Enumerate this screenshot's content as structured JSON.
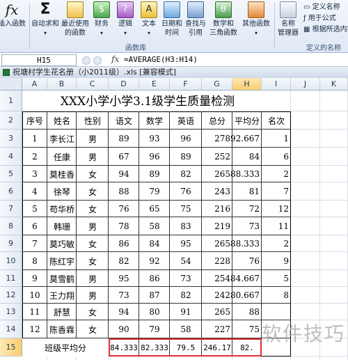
{
  "ribbon": {
    "buttons": [
      {
        "label": "插入函数",
        "icon": "insert-function-icon"
      },
      {
        "label": "自动求和",
        "icon": "autosum-icon",
        "has_dropdown": true
      },
      {
        "label": "最近使用的函数",
        "line1": "最近使用",
        "line2": "的函数",
        "icon": "recent-functions-icon",
        "has_dropdown": true
      },
      {
        "label": "财务",
        "icon": "financial-icon",
        "has_dropdown": true
      },
      {
        "label": "逻辑",
        "icon": "logical-icon",
        "has_dropdown": true
      },
      {
        "label": "文本",
        "icon": "text-icon",
        "has_dropdown": true
      },
      {
        "label": "日期和时间",
        "line1": "日期和",
        "line2": "时间",
        "icon": "date-time-icon",
        "has_dropdown": true
      },
      {
        "label": "查找与引用",
        "line1": "查找与",
        "line2": "引用",
        "icon": "lookup-icon",
        "has_dropdown": true
      },
      {
        "label": "数学和三角函数",
        "line1": "数学和",
        "line2": "三角函数",
        "icon": "math-trig-icon",
        "has_dropdown": true
      },
      {
        "label": "其他函数",
        "icon": "more-functions-icon",
        "has_dropdown": true
      },
      {
        "label": "名称管理器",
        "line1": "名称",
        "line2": "管理器",
        "icon": "name-manager-icon"
      }
    ],
    "group_function_library": "函数库",
    "group_defined_names": "定义的名称",
    "define_name": "定义名称",
    "use_in_formula": "用于公式",
    "create_from_selection": "根据所选内容"
  },
  "formula_bar": {
    "name_box": "H15",
    "fx": "fx",
    "formula": "=AVERAGE(H3:H14)"
  },
  "workbook": {
    "title": "祝塘村学生花名册（小2011级）.xls  [兼容模式]"
  },
  "columns": [
    "A",
    "B",
    "C",
    "D",
    "E",
    "F",
    "G",
    "H",
    "I",
    "J",
    "K"
  ],
  "rows": [
    "1",
    "2",
    "3",
    "4",
    "5",
    "6",
    "7",
    "8",
    "9",
    "10",
    "11",
    "12",
    "13",
    "14",
    "15"
  ],
  "sheet": {
    "title": "XXX小学小学3.1级学生质量检测",
    "headers": [
      "序号",
      "姓名",
      "性别",
      "语文",
      "数学",
      "英语",
      "总分",
      "平均分",
      "名次"
    ],
    "students": [
      {
        "no": "1",
        "name": "李长江",
        "sex": "男",
        "chinese": "89",
        "math": "93",
        "english": "96",
        "total": "278",
        "avg": "92.667",
        "rank": "1"
      },
      {
        "no": "2",
        "name": "任康",
        "sex": "男",
        "chinese": "67",
        "math": "96",
        "english": "89",
        "total": "252",
        "avg": "84",
        "rank": "6"
      },
      {
        "no": "3",
        "name": "莫桂香",
        "sex": "女",
        "chinese": "94",
        "math": "89",
        "english": "82",
        "total": "265",
        "avg": "88.333",
        "rank": "2"
      },
      {
        "no": "4",
        "name": "徐琴",
        "sex": "女",
        "chinese": "88",
        "math": "79",
        "english": "76",
        "total": "243",
        "avg": "81",
        "rank": "7"
      },
      {
        "no": "5",
        "name": "苟华桥",
        "sex": "女",
        "chinese": "76",
        "math": "65",
        "english": "75",
        "total": "216",
        "avg": "72",
        "rank": "12"
      },
      {
        "no": "6",
        "name": "韩珊",
        "sex": "男",
        "chinese": "78",
        "math": "58",
        "english": "83",
        "total": "219",
        "avg": "73",
        "rank": "11"
      },
      {
        "no": "7",
        "name": "莫巧敏",
        "sex": "女",
        "chinese": "86",
        "math": "84",
        "english": "95",
        "total": "265",
        "avg": "88.333",
        "rank": "2"
      },
      {
        "no": "8",
        "name": "陈红宇",
        "sex": "女",
        "chinese": "82",
        "math": "92",
        "english": "54",
        "total": "228",
        "avg": "76",
        "rank": "9"
      },
      {
        "no": "9",
        "name": "莫雪鹤",
        "sex": "男",
        "chinese": "95",
        "math": "86",
        "english": "73",
        "total": "254",
        "avg": "84.667",
        "rank": "5"
      },
      {
        "no": "10",
        "name": "王力翔",
        "sex": "男",
        "chinese": "73",
        "math": "87",
        "english": "82",
        "total": "242",
        "avg": "80.667",
        "rank": "8"
      },
      {
        "no": "11",
        "name": "舒慧",
        "sex": "女",
        "chinese": "94",
        "math": "80",
        "english": "91",
        "total": "265",
        "avg": "88",
        "rank": ""
      },
      {
        "no": "12",
        "name": "陈香霖",
        "sex": "女",
        "chinese": "90",
        "math": "79",
        "english": "58",
        "total": "227",
        "avg": "75",
        "rank": ""
      }
    ],
    "avg_row": {
      "label": "班级平均分",
      "chinese": "84.333",
      "math": "82.333",
      "english": "79.5",
      "total": "246.17",
      "avg": "82."
    }
  },
  "watermark": "软件技巧"
}
